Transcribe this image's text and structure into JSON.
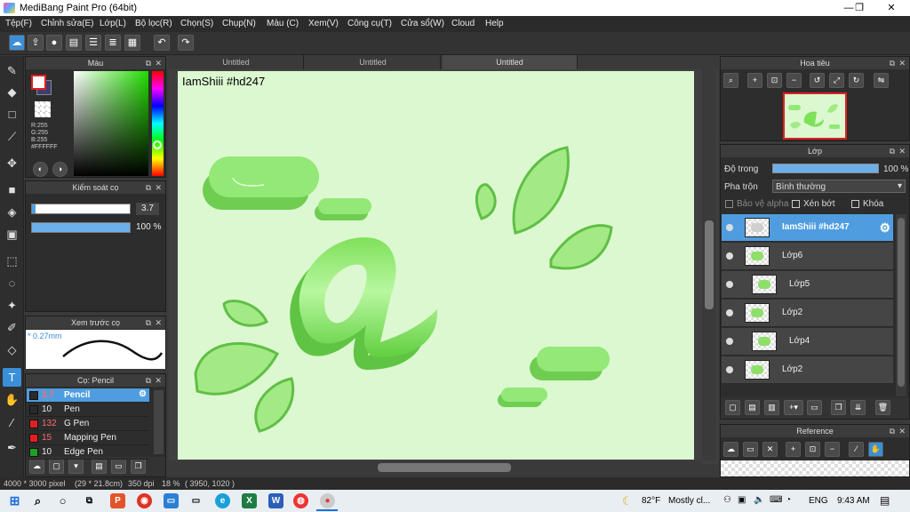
{
  "app": {
    "title": "MediBang Paint Pro (64bit)"
  },
  "window_controls": {
    "minimize": "—",
    "maximize": "❐",
    "close": "✕"
  },
  "menu": [
    "Tệp(F)",
    "Chỉnh sửa(E)",
    "Lớp(L)",
    "Bộ lọc(R)",
    "Chọn(S)",
    "Chụp(N)",
    "Màu (C)",
    "Xem(V)",
    "Công cụ(T)",
    "Cửa sổ(W)",
    "Cloud",
    "Help"
  ],
  "toolbar_icons": [
    "cloud-icon",
    "upload-icon",
    "comment-icon",
    "note-icon",
    "list-icon",
    "grid-icon",
    "undo-icon",
    "redo-icon"
  ],
  "color_panel": {
    "title": "Màu",
    "r": "R:255",
    "g": "G:255",
    "b": "B:255",
    "hex": "#FFFFFF",
    "primary": "#ffffff",
    "secondary": "#3e3e6e"
  },
  "brush_control": {
    "title": "Kiểm soát cọ",
    "size": "3.7",
    "opacity": "100 %"
  },
  "brush_preview": {
    "title": "Xem trước cọ",
    "size_label": "* 0.27mm"
  },
  "brush_list": {
    "title": "Cọ: Pencil",
    "items": [
      {
        "size": "3.7",
        "name": "Pencil",
        "color": "#2a2a2a",
        "selected": true
      },
      {
        "size": "10",
        "name": "Pen",
        "color": "#2a2a2a",
        "selected": false
      },
      {
        "size": "132",
        "name": "G Pen",
        "color": "#e02020",
        "selected": false
      },
      {
        "size": "15",
        "name": "Mapping Pen",
        "color": "#e02020",
        "selected": false
      },
      {
        "size": "10",
        "name": "Edge Pen",
        "color": "#20a020",
        "selected": false
      }
    ]
  },
  "tabs": [
    "Untitled",
    "Untitled",
    "Untitled"
  ],
  "canvas": {
    "label": "IamShiii #hd247",
    "background": "#dcf8d0",
    "accent": "#8ee06a"
  },
  "navigator": {
    "title": "Hoa tiêu"
  },
  "layer_panel": {
    "title": "Lớp",
    "opacity_label": "Độ trong",
    "opacity_value": "100 %",
    "blend_label": "Pha trộn",
    "blend_value": "Bình thường",
    "protect_alpha": "Bảo vệ alpha",
    "clipping": "Xén bớt",
    "lock": "Khóa",
    "layers": [
      {
        "name": "IamShiii #hd247",
        "selected": true,
        "indent": false
      },
      {
        "name": "Lớp6",
        "selected": false,
        "indent": false
      },
      {
        "name": "Lớp5",
        "selected": false,
        "indent": true
      },
      {
        "name": "Lớp2",
        "selected": false,
        "indent": false
      },
      {
        "name": "Lớp4",
        "selected": false,
        "indent": true
      },
      {
        "name": "Lớp2",
        "selected": false,
        "indent": false
      }
    ]
  },
  "reference": {
    "title": "Reference"
  },
  "status": {
    "size": "4000 * 3000 pixel",
    "cm": "(29 * 21.8cm)",
    "dpi": "350 dpi",
    "zoom": "18 %",
    "coords": "( 3950, 1020 )"
  },
  "taskbar": {
    "weather_temp": "82°F",
    "weather_text": "Mostly cl...",
    "lang": "ENG",
    "time": "9:43 AM"
  }
}
